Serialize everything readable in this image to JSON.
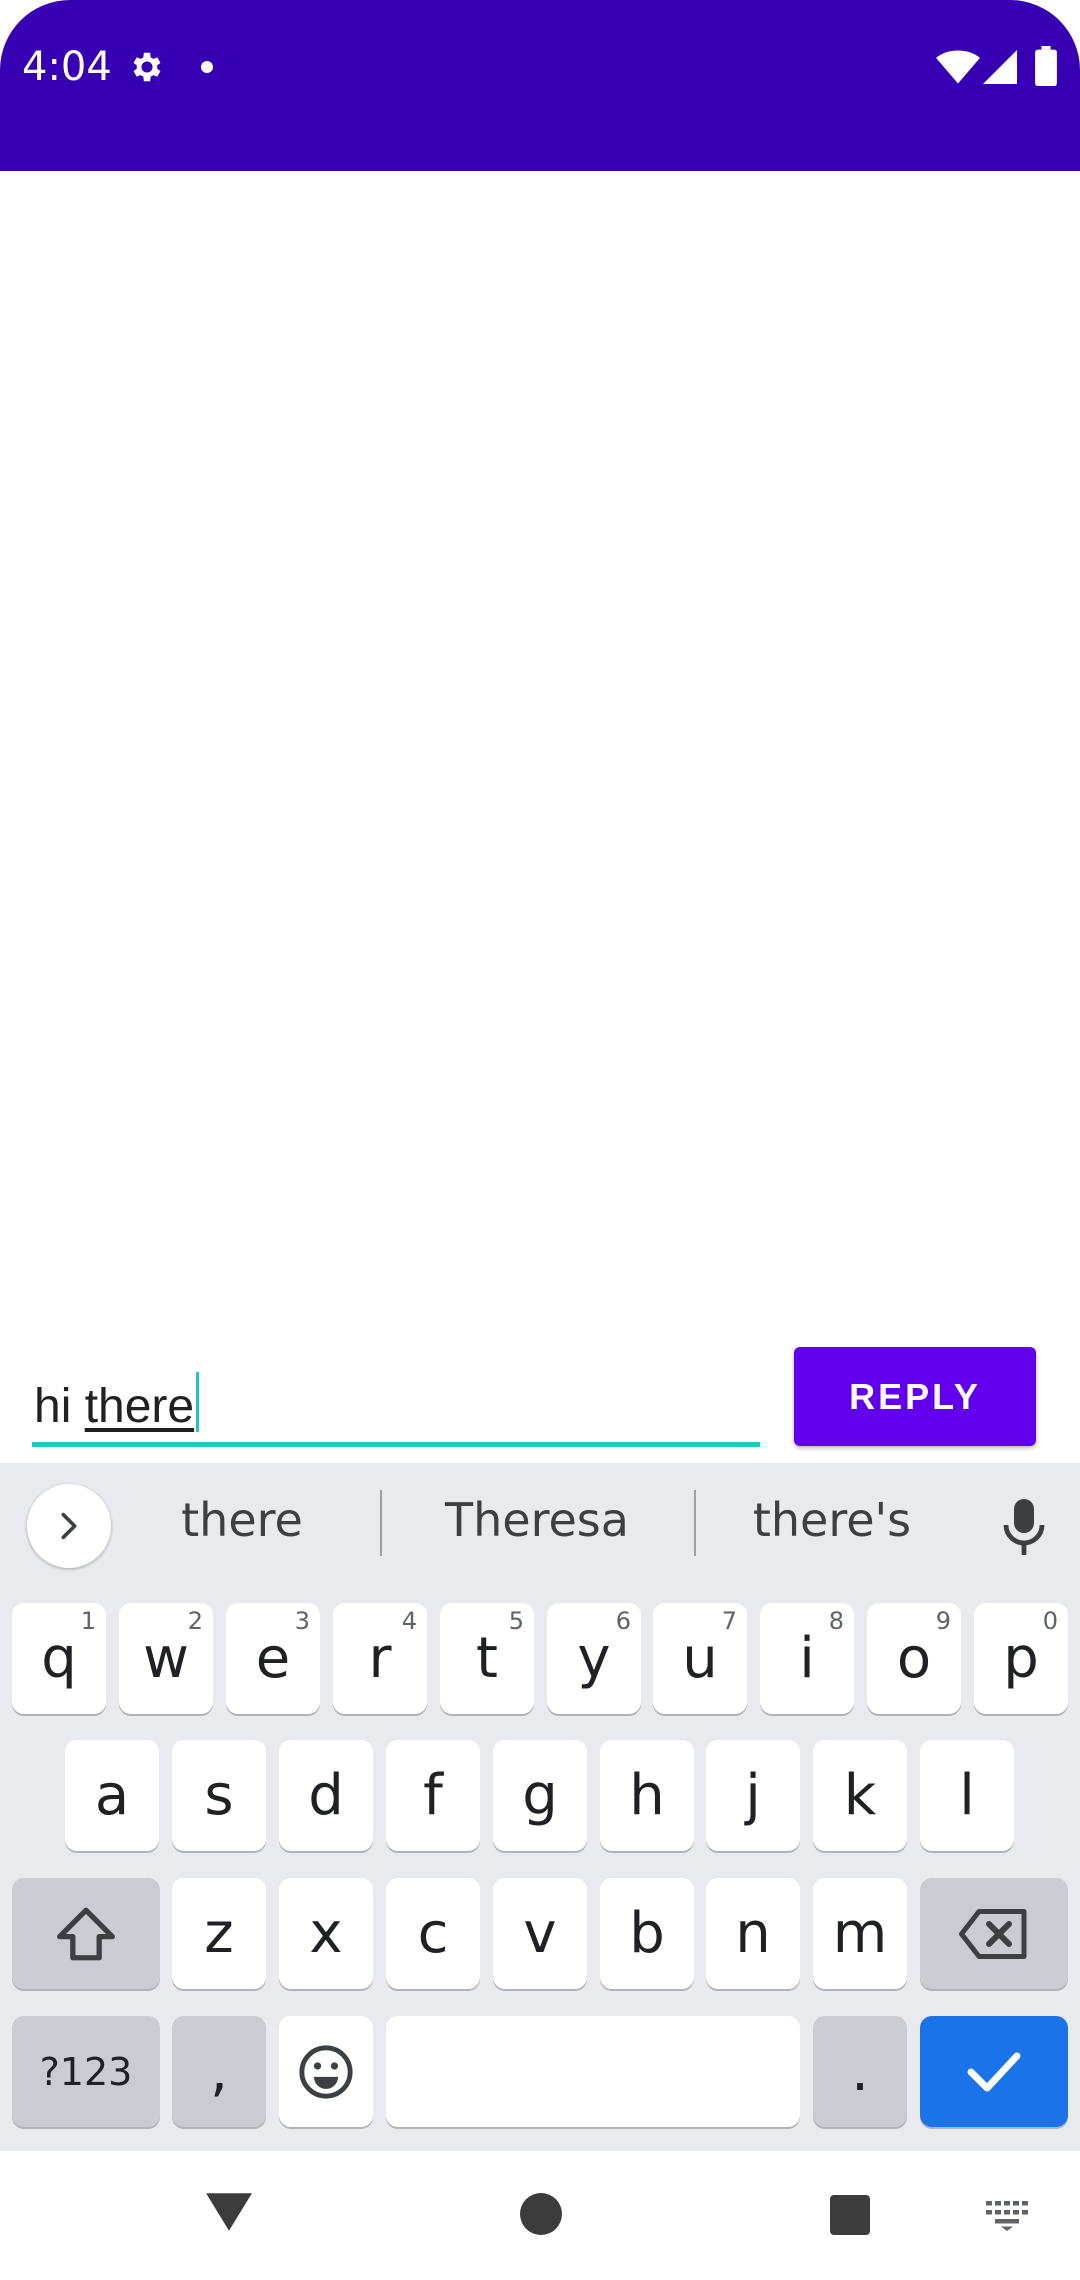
{
  "status_bar": {
    "time": "4:04",
    "color": "#3700b3"
  },
  "reply": {
    "input_text_plain": "hi ",
    "input_text_composing": "there",
    "button_label": "REPLY",
    "button_color": "#6200ee",
    "underline_color": "#1fc8b9"
  },
  "keyboard": {
    "suggestions": [
      "there",
      "Theresa",
      "there's"
    ],
    "row1": [
      {
        "label": "q",
        "hint": "1"
      },
      {
        "label": "w",
        "hint": "2"
      },
      {
        "label": "e",
        "hint": "3"
      },
      {
        "label": "r",
        "hint": "4"
      },
      {
        "label": "t",
        "hint": "5"
      },
      {
        "label": "y",
        "hint": "6"
      },
      {
        "label": "u",
        "hint": "7"
      },
      {
        "label": "i",
        "hint": "8"
      },
      {
        "label": "o",
        "hint": "9"
      },
      {
        "label": "p",
        "hint": "0"
      }
    ],
    "row2": [
      "a",
      "s",
      "d",
      "f",
      "g",
      "h",
      "j",
      "k",
      "l"
    ],
    "row3": [
      "z",
      "x",
      "c",
      "v",
      "b",
      "n",
      "m"
    ],
    "symbols_label": "?123",
    "comma_label": ",",
    "period_label": ".",
    "enter_color": "#1a73e8"
  },
  "icons": {
    "status": [
      "gear-icon",
      "notification-dot-icon",
      "wifi-icon",
      "cell-signal-icon",
      "battery-icon"
    ],
    "keyboard": [
      "chevron-right-icon",
      "microphone-icon",
      "shift-icon",
      "backspace-icon",
      "emoji-icon",
      "checkmark-icon"
    ],
    "nav": [
      "back-icon",
      "home-icon",
      "recents-icon",
      "keyboard-switch-icon"
    ]
  }
}
